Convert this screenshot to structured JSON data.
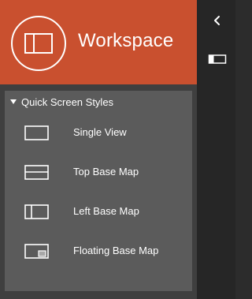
{
  "header": {
    "title": "Workspace",
    "logo_icon": "workspace-layout-icon",
    "bg_color": "#c9502f"
  },
  "rail": {
    "collapse_icon": "chevron-left-icon",
    "layout_toggle_icon": "panel-layout-icon"
  },
  "quick_styles": {
    "title": "Quick Screen Styles",
    "expanded": true,
    "items": [
      {
        "label": "Single View",
        "icon": "single-view-icon"
      },
      {
        "label": "Top Base Map",
        "icon": "top-base-map-icon"
      },
      {
        "label": "Left Base Map",
        "icon": "left-base-map-icon"
      },
      {
        "label": "Floating Base Map",
        "icon": "floating-base-map-icon"
      }
    ]
  }
}
